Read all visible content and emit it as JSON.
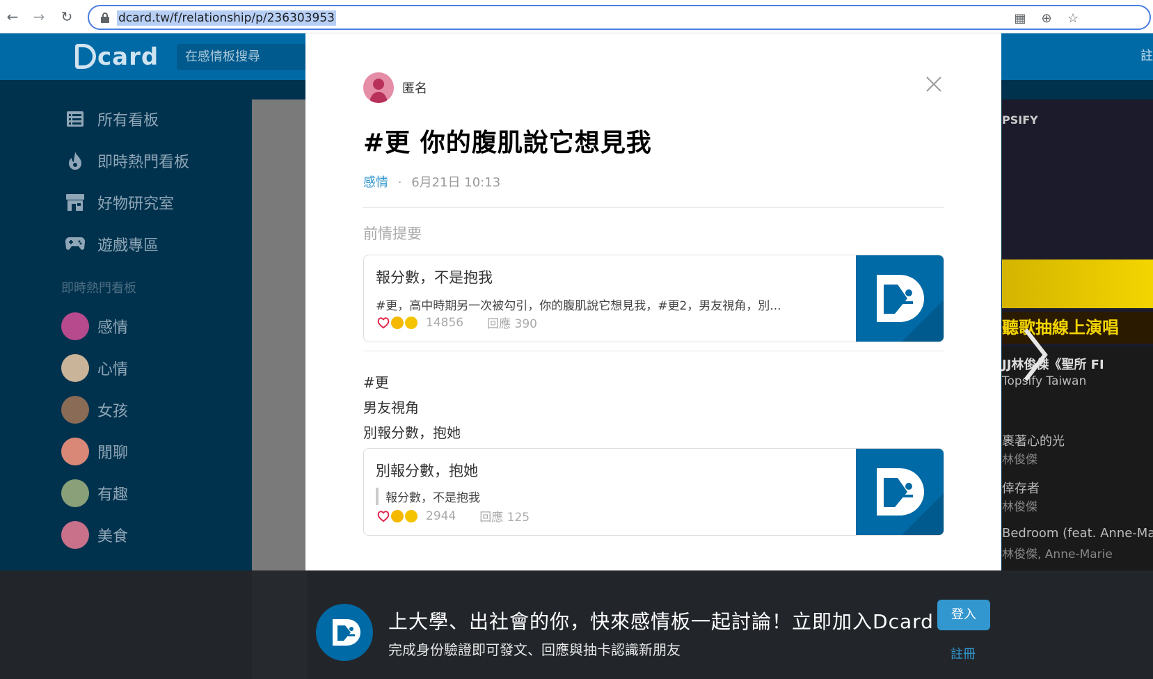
{
  "browser": {
    "url": "dcard.tw/f/relationship/p/236303953"
  },
  "header": {
    "logo": "card",
    "search_placeholder": "在感情板搜尋",
    "right_text": "註"
  },
  "sidebar": {
    "items": [
      {
        "label": "所有看板",
        "icon": "list-icon"
      },
      {
        "label": "即時熱門看板",
        "icon": "fire-icon"
      },
      {
        "label": "好物研究室",
        "icon": "store-icon"
      },
      {
        "label": "遊戲專區",
        "icon": "gamepad-icon"
      }
    ],
    "section_title": "即時熱門看板",
    "boards": [
      {
        "label": "感情",
        "color": "#b74a8c"
      },
      {
        "label": "心情",
        "color": "#c9b49a"
      },
      {
        "label": "女孩",
        "color": "#8a6b55"
      },
      {
        "label": "閒聊",
        "color": "#d98878"
      },
      {
        "label": "有趣",
        "color": "#8aa078"
      },
      {
        "label": "美食",
        "color": "#c9708a"
      }
    ]
  },
  "post": {
    "author": "匿名",
    "title": "#更 你的腹肌說它想見我",
    "board": "感情",
    "separator": "·",
    "time": "6月21日 10:13",
    "section_label": "前情提要",
    "card1": {
      "title": "報分數，不是抱我",
      "excerpt": "#更，高中時期另一次被勾引，你的腹肌說它想見我，#更2，男友視角，別...",
      "likes": "14856",
      "replies": "回應 390"
    },
    "body_lines": [
      "#更",
      "男友視角",
      "別報分數，抱她"
    ],
    "card2": {
      "title": "別報分數，抱她",
      "quote": "報分數，不是抱我",
      "likes": "2944",
      "replies": "回應 125"
    }
  },
  "right_panel": {
    "ad_brand": "PSIFY",
    "ad_strip": "聽歌抽線上演唱",
    "song_title": "JJ林俊傑《聖所 FI",
    "channel": "Topsify Taiwan",
    "tracks": [
      {
        "title": "裹著心的光",
        "artist": "林俊傑"
      },
      {
        "title": "倖存者",
        "artist": "林俊傑"
      },
      {
        "title": "Bedroom (feat. Anne-Marie",
        "artist": "林俊傑, Anne-Marie"
      }
    ]
  },
  "cta": {
    "title": "上大學、出社會的你，快來感情板一起討論！立即加入Dcard ！",
    "subtitle": "完成身份驗證即可發文、回應與抽卡認識新朋友",
    "login": "登入",
    "register": "註冊"
  }
}
